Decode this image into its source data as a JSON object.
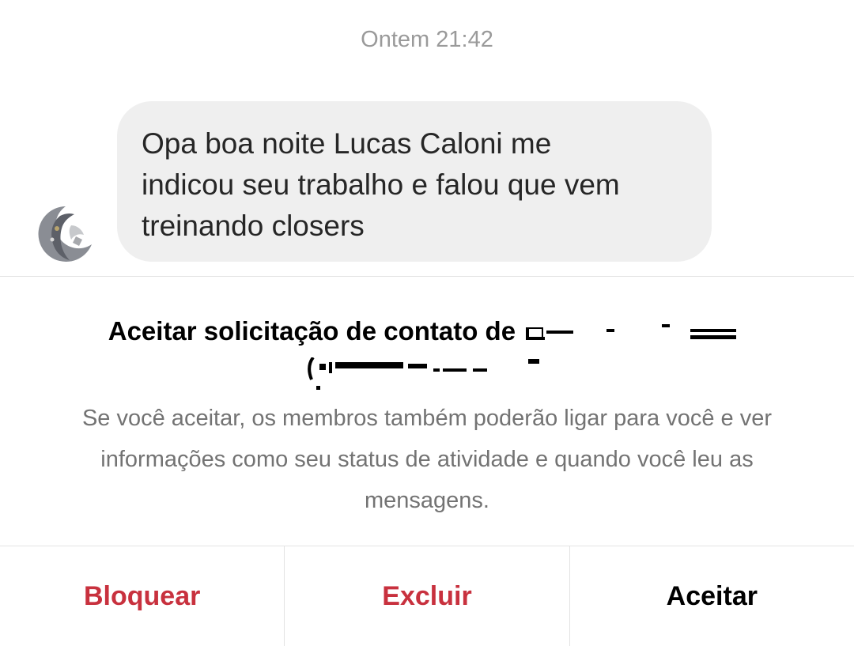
{
  "thread": {
    "timestamp": "Ontem 21:42",
    "message": {
      "lines": [
        "Opa boa noite Lucas Caloni me",
        "indicou seu trabalho e falou que vem",
        "treinando closers"
      ]
    },
    "sender_avatar_icon": "profile-photo"
  },
  "request": {
    "title_prefix": "Aceitar solicitação de contato de",
    "description_lines": [
      "Se você aceitar, os membros também poderão ligar para você e ver",
      "informações como seu status de atividade e quando você leu as",
      "mensagens."
    ]
  },
  "actions": {
    "block_label": "Bloquear",
    "delete_label": "Excluir",
    "accept_label": "Aceitar"
  },
  "colors": {
    "danger": "#c8313e",
    "bubble": "#efefef",
    "muted_text": "#737373"
  }
}
